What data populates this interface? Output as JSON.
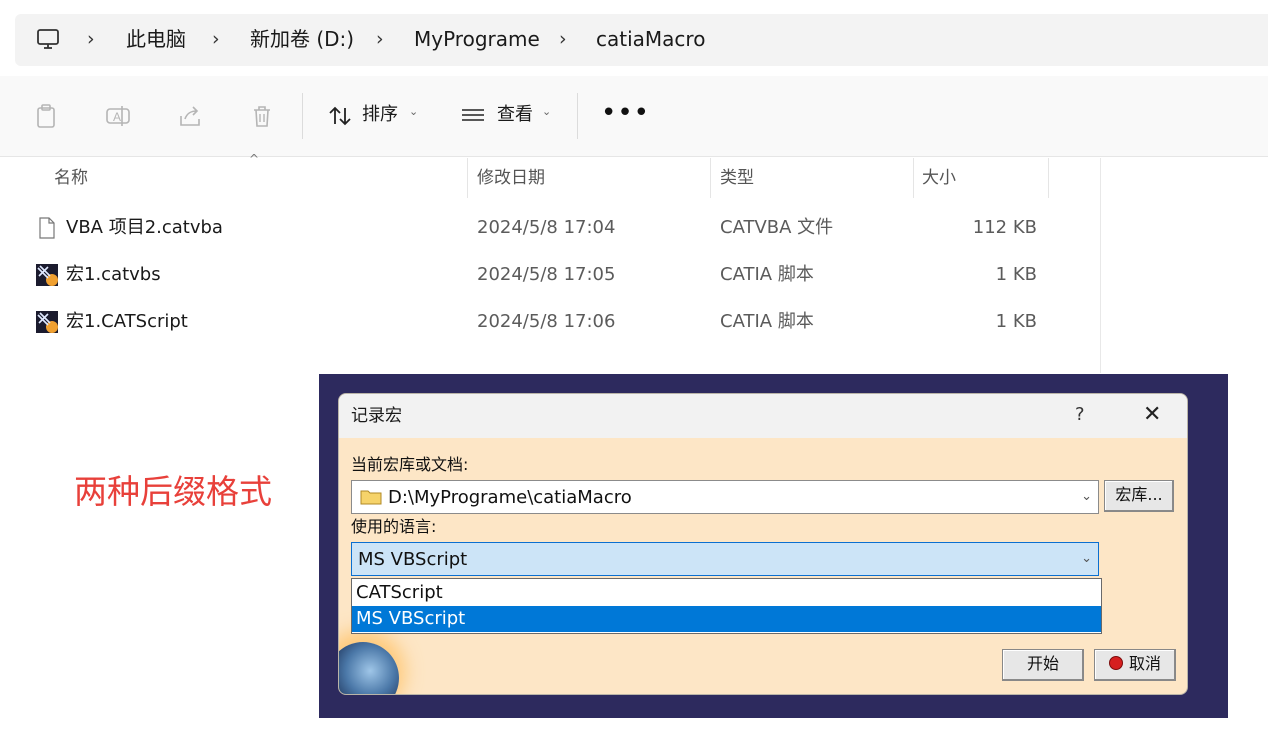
{
  "breadcrumb": {
    "items": [
      "此电脑",
      "新加卷 (D:)",
      "MyPrograme",
      "catiaMacro"
    ],
    "separator": "›"
  },
  "toolbar": {
    "sort_label": "排序",
    "view_label": "查看",
    "more_label": "•••",
    "icons": [
      "paste-icon",
      "rename-icon",
      "share-icon",
      "delete-icon",
      "sort-icon",
      "view-icon"
    ]
  },
  "columns": [
    "名称",
    "修改日期",
    "类型",
    "大小"
  ],
  "files": [
    {
      "name": "VBA 项目2.catvba",
      "modified": "2024/5/8 17:04",
      "type": "CATVBA 文件",
      "size": "112 KB",
      "icon": "document-icon"
    },
    {
      "name": "宏1.catvbs",
      "modified": "2024/5/8 17:05",
      "type": "CATIA 脚本",
      "size": "1 KB",
      "icon": "catia-icon"
    },
    {
      "name": "宏1.CATScript",
      "modified": "2024/5/8 17:06",
      "type": "CATIA 脚本",
      "size": "1 KB",
      "icon": "catia-icon"
    }
  ],
  "annotation": "两种后缀格式",
  "dialog": {
    "title": "记录宏",
    "help": "?",
    "close": "✕",
    "library_label": "当前宏库或文档:",
    "library_value": "D:\\MyPrograme\\catiaMacro",
    "library_button": "宏库...",
    "language_label": "使用的语言:",
    "language_value": "MS VBScript",
    "language_options": [
      "CATScript",
      "MS VBScript"
    ],
    "language_selected_index": 1,
    "start_button": "开始",
    "cancel_button": "取消"
  },
  "colors": {
    "annotation": "#e8403a",
    "dialog_body": "#fde6c6",
    "selection": "#0078d7",
    "dialog_frame": "#2d2a5e"
  }
}
